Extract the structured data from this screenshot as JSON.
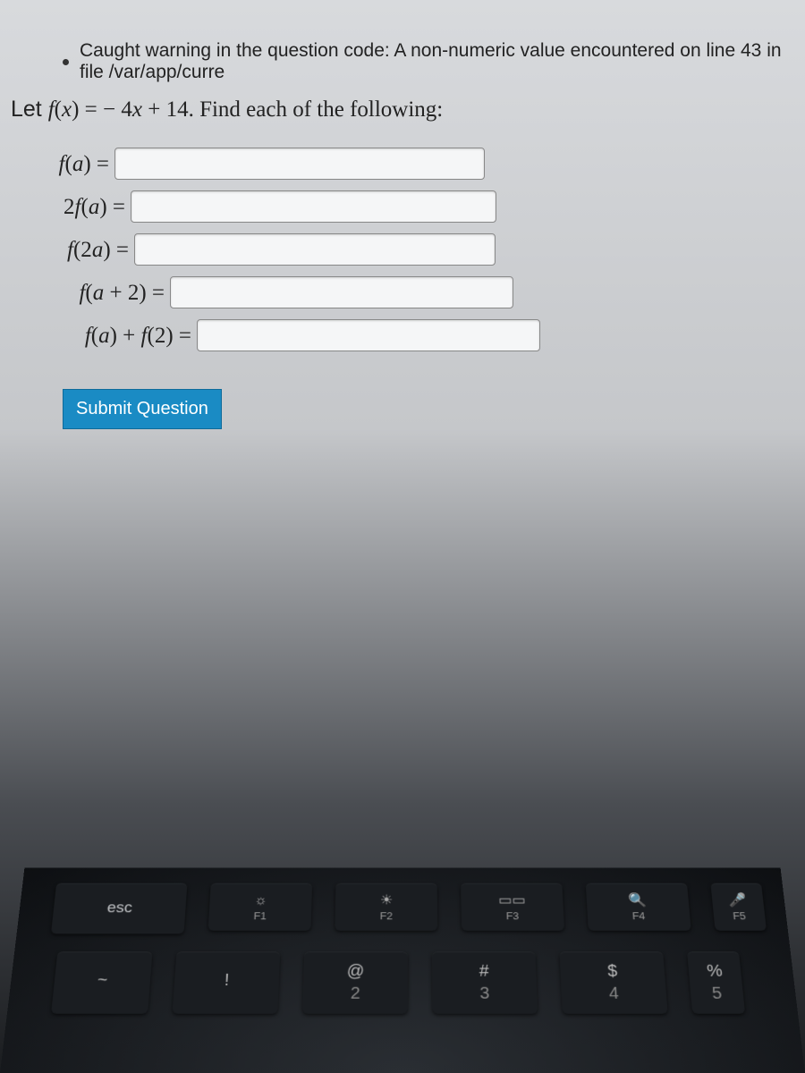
{
  "warning": "Caught warning in the question code: A non-numeric value encountered on line 43 in file /var/app/curre",
  "question_prefix": "Let ",
  "question_fn": "f",
  "question_arg": "x",
  "question_eq": " =  − 4",
  "question_var2": "x",
  "question_rest": " + 14. Find each of the following:",
  "rows": {
    "r1": "f(a) = ",
    "r2": "2f(a) = ",
    "r3": "f(2a) = ",
    "r4": "f(a + 2) = ",
    "r5": "f(a) + f(2) = "
  },
  "submit": "Submit Question",
  "keys": {
    "esc": "esc",
    "f1": "F1",
    "f2": "F2",
    "f3": "F3",
    "f4": "F4",
    "f5": "F5",
    "tilde_top": "~",
    "k1_top": "!",
    "k2_top": "@",
    "k2_bot": "2",
    "k3_top": "#",
    "k3_bot": "3",
    "k4_top": "$",
    "k4_bot": "4",
    "k5_top": "%",
    "k5_bot": "5"
  }
}
